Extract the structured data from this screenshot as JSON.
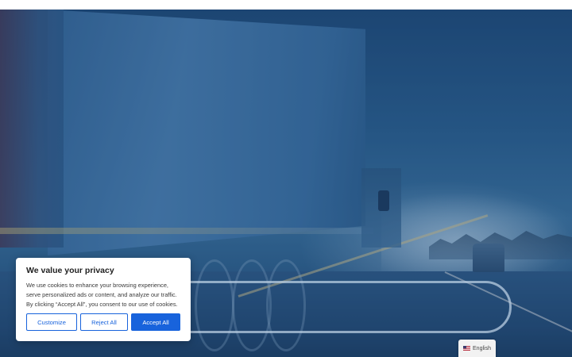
{
  "cookie_banner": {
    "title": "We value your privacy",
    "text_line1": "We use cookies to enhance your browsing experience,",
    "text_line2": "serve personalized ads or content, and analyze our traffic.",
    "text_line3": "By clicking “Accept All”, you consent to our use of cookies.",
    "customize_label": "Customize",
    "reject_label": "Reject All",
    "accept_label": "Accept All",
    "accent_color": "#1863dc"
  },
  "language_switcher": {
    "flag_icon": "us-flag-icon",
    "label": "English"
  },
  "hero": {
    "image_subject": "truck-on-highway"
  }
}
